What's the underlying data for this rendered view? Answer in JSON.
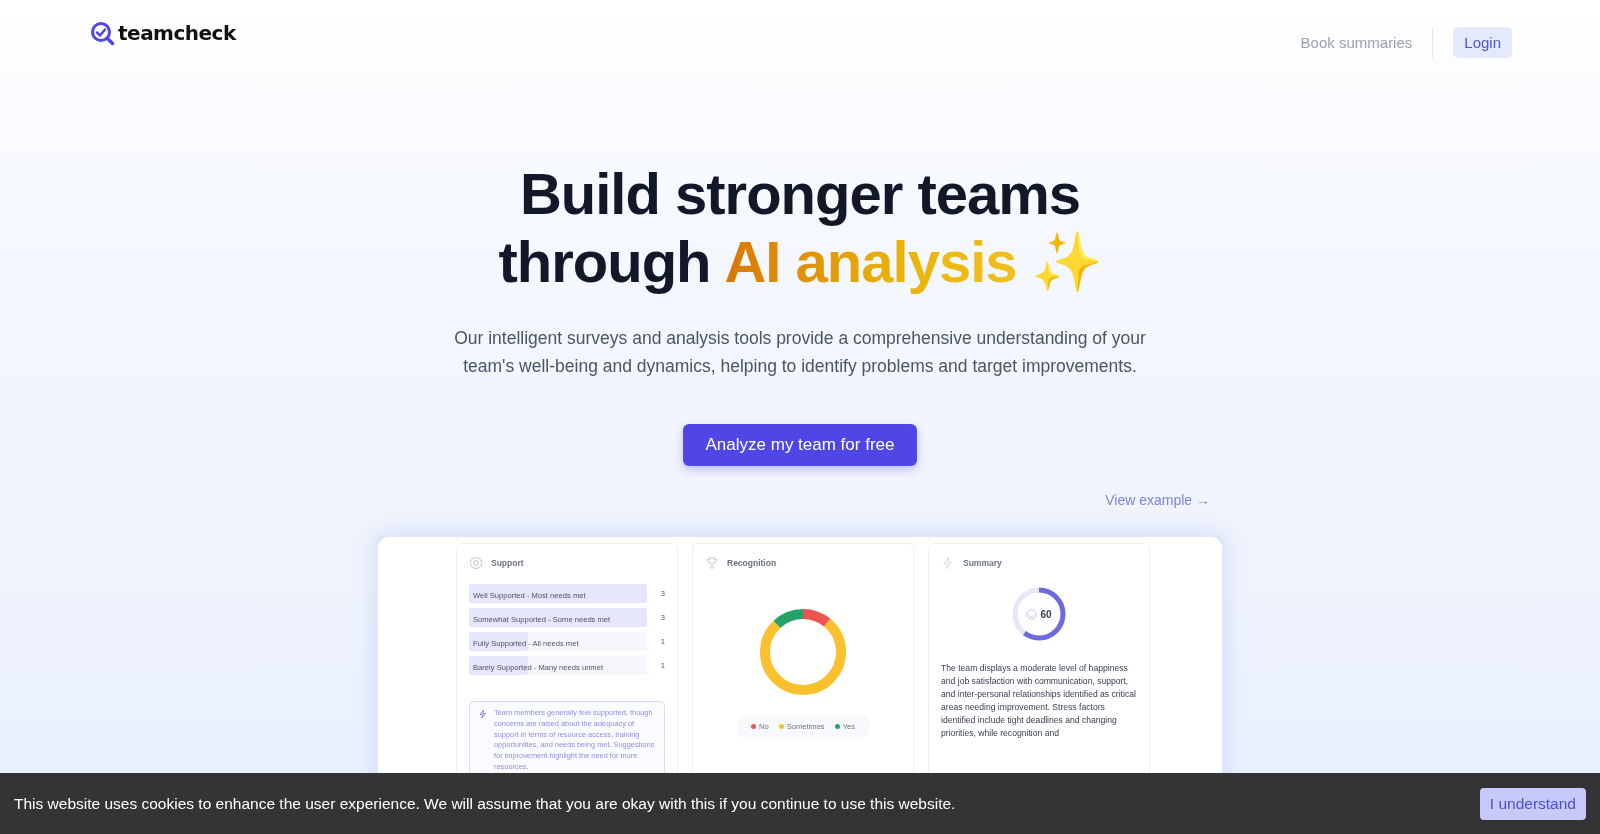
{
  "header": {
    "logo_text": "teamcheck",
    "nav": [
      {
        "label": "Book summaries",
        "kind": "link"
      },
      {
        "label": "Login",
        "kind": "button"
      }
    ]
  },
  "hero": {
    "title_line_1": "Build stronger teams",
    "title_line_2": "through",
    "highlight": "AI analysis",
    "sparkle": "✨",
    "subtitle": "Our intelligent surveys and analysis tools provide a comprehensive understanding of your team's well-being and dynamics, helping to identify problems and target improvements.",
    "cta": "Analyze my team for free",
    "example_link": "View example",
    "example_arrow": "→"
  },
  "preview": {
    "support": {
      "title": "Support",
      "rows": [
        {
          "label": "Well Supported - Most needs met",
          "count": "3",
          "level": 1
        },
        {
          "label": "Somewhat Supported - Some needs met",
          "count": "3",
          "level": 1
        },
        {
          "label": "Fully Supported - All needs met",
          "count": "1",
          "level": 0.33
        },
        {
          "label": "Barely Supported - Many needs unmet",
          "count": "1",
          "level": 0.33
        }
      ],
      "insight": "Team members generally feel supported, though concerns are raised about the adequacy of support in terms of resource access, training opportunities, and needs being met. Suggestions for improvement highlight the need for more resources,"
    },
    "recognition": {
      "title": "Recognition",
      "legend": [
        {
          "label": "No",
          "color": "#ef5350"
        },
        {
          "label": "Sometimes",
          "color": "#fbc02d"
        },
        {
          "label": "Yes",
          "color": "#26a269"
        }
      ]
    },
    "summary": {
      "title": "Summary",
      "score": "60",
      "level": 0.6,
      "text": "The team displays a moderate level of happiness and job satisfaction with communication, support, and inter-personal relationships identified as critical areas needing improvement. Stress factors identified include tight deadlines and changing priorities, while recognition and"
    }
  },
  "cookie_bar": {
    "message": "This website uses cookies to enhance the user experience. We will assume that you are okay with this if you continue to use this website.",
    "button": "I understand"
  }
}
